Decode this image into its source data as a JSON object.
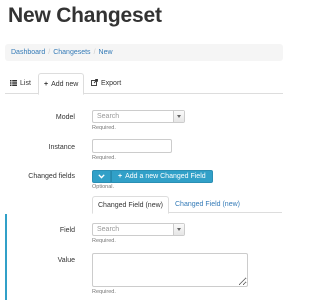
{
  "page": {
    "title": "New Changeset"
  },
  "breadcrumb": [
    {
      "label": "Dashboard"
    },
    {
      "label": "Changesets"
    },
    {
      "label": "New"
    }
  ],
  "breadcrumb_separator": "/",
  "tabs": [
    {
      "label": "List",
      "icon": "list-icon"
    },
    {
      "label": "Add new",
      "icon": "plus-icon",
      "active": true
    },
    {
      "label": "Export",
      "icon": "export-icon"
    }
  ],
  "form": {
    "model": {
      "label": "Model",
      "placeholder": "Search",
      "help": "Required."
    },
    "instance": {
      "label": "Instance",
      "value": "",
      "help": "Required."
    },
    "changed_fields": {
      "label": "Changed fields",
      "add_button": "Add a new Changed Field",
      "help": "Optional.",
      "subtabs": [
        {
          "label": "Changed Field (new)",
          "active": true
        },
        {
          "label": "Changed Field (new)",
          "active": false
        }
      ]
    },
    "field": {
      "label": "Field",
      "placeholder": "Search",
      "help": "Required."
    },
    "value": {
      "label": "Value",
      "value": "",
      "help": "Required."
    }
  },
  "colors": {
    "accent": "#31a0c8",
    "link": "#337ab7"
  }
}
